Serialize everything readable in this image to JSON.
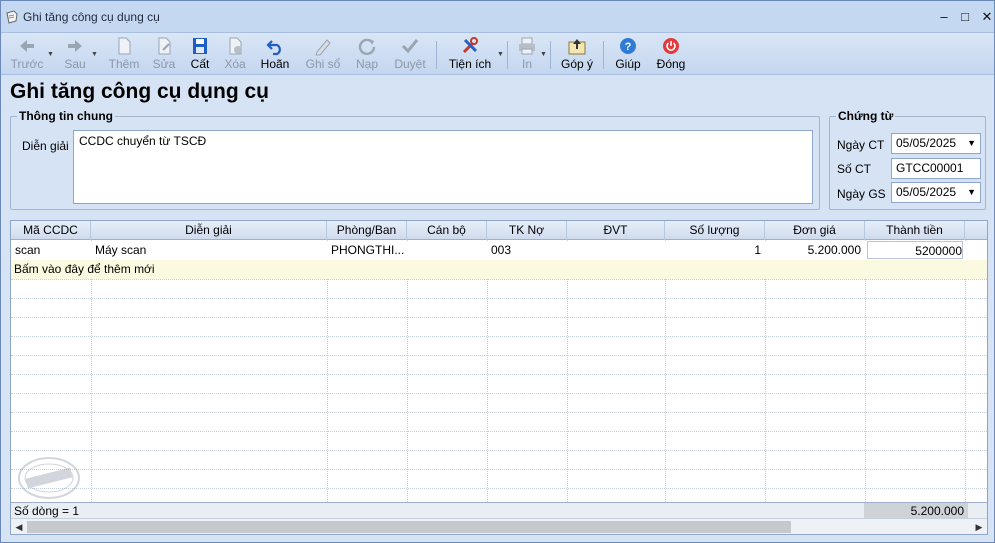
{
  "window": {
    "title": "Ghi tăng công cụ dụng cụ",
    "controls": {
      "minimize": "‒",
      "maximize": "□",
      "close": "✕"
    }
  },
  "toolbar": {
    "back": "Trước",
    "forward": "Sau",
    "add": "Thêm",
    "edit": "Sửa",
    "save": "Cất",
    "delete": "Xóa",
    "undo": "Hoãn",
    "post": "Ghi sổ",
    "load": "Nạp",
    "approve": "Duyệt",
    "utilities": "Tiện ích",
    "print": "In",
    "feedback": "Góp ý",
    "help": "Giúp",
    "close": "Đóng"
  },
  "page": {
    "heading": "Ghi tăng công cụ dụng cụ"
  },
  "general": {
    "legend": "Thông tin chung",
    "description_label": "Diễn giải",
    "description_value": "CCDC chuyển từ TSCĐ"
  },
  "voucher": {
    "legend": "Chứng từ",
    "date_label": "Ngày CT",
    "date_value": "05/05/2025",
    "number_label": "Số CT",
    "number_value": "GTCC00001",
    "post_date_label": "Ngày GS",
    "post_date_value": "05/05/2025"
  },
  "grid": {
    "columns": [
      "Mã CCDC",
      "Diễn giải",
      "Phòng/Ban",
      "Cán bộ",
      "TK Nợ",
      "ĐVT",
      "Số lượng",
      "Đơn giá",
      "Thành tiền"
    ],
    "rows": [
      {
        "code": "scan",
        "description": "Máy scan",
        "department": "PHONGTHI...",
        "staff": "",
        "debit_account": "003",
        "unit": "",
        "quantity": "1",
        "unit_price": "5.200.000",
        "amount": "5200000"
      }
    ],
    "new_row_hint": "Bấm vào đây để thêm mới",
    "row_count": "Số dòng = 1",
    "total_amount": "5.200.000"
  },
  "colors": {
    "title_bar": "#c5d8f2",
    "background": "#d6e3f4",
    "new_row": "#fbfae0",
    "help_icon": "#2f7bd6",
    "close_icon": "#e23b3b"
  }
}
